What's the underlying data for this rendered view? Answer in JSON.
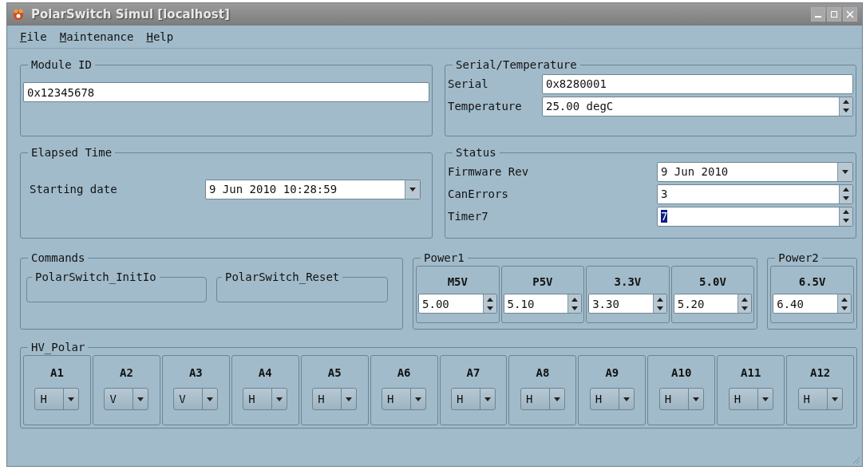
{
  "window": {
    "title": "PolarSwitch Simul [localhost]"
  },
  "menu": [
    "File",
    "Maintenance",
    "Help"
  ],
  "module_id": {
    "title": "Module ID",
    "value": "0x12345678"
  },
  "serial_temperature": {
    "title": "Serial/Temperature",
    "fields": [
      {
        "label": "Serial",
        "value": "0x8280001",
        "kind": "text"
      },
      {
        "label": "Temperature",
        "value": "25.00 degC",
        "kind": "spin"
      }
    ]
  },
  "elapsed_time": {
    "title": "Elapsed Time",
    "label": "Starting date",
    "value": "9 Jun 2010 10:28:59"
  },
  "status": {
    "title": "Status",
    "fields": [
      {
        "label": "Firmware Rev",
        "value": "9 Jun 2010",
        "kind": "combo",
        "text_selected": false
      },
      {
        "label": "CanErrors",
        "value": "3",
        "kind": "spin",
        "text_selected": false
      },
      {
        "label": "Timer7",
        "value": "7",
        "kind": "spin",
        "text_selected": true
      }
    ]
  },
  "commands": {
    "title": "Commands",
    "buttons": [
      "PolarSwitch_InitIo",
      "PolarSwitch_Reset"
    ]
  },
  "power1": {
    "title": "Power1",
    "channels": [
      {
        "label": "M5V",
        "value": "5.00"
      },
      {
        "label": "P5V",
        "value": "5.10"
      },
      {
        "label": "3.3V",
        "value": "3.30"
      },
      {
        "label": "5.0V",
        "value": "5.20"
      }
    ]
  },
  "power2": {
    "title": "Power2",
    "channels": [
      {
        "label": "6.5V",
        "value": "6.40"
      }
    ]
  },
  "hv_polar": {
    "title": "HV_Polar",
    "channels": [
      {
        "label": "A1",
        "value": "H"
      },
      {
        "label": "A2",
        "value": "V"
      },
      {
        "label": "A3",
        "value": "V"
      },
      {
        "label": "A4",
        "value": "H"
      },
      {
        "label": "A5",
        "value": "H"
      },
      {
        "label": "A6",
        "value": "H"
      },
      {
        "label": "A7",
        "value": "H"
      },
      {
        "label": "A8",
        "value": "H"
      },
      {
        "label": "A9",
        "value": "H"
      },
      {
        "label": "A10",
        "value": "H"
      },
      {
        "label": "A11",
        "value": "H"
      },
      {
        "label": "A12",
        "value": "H"
      }
    ]
  }
}
